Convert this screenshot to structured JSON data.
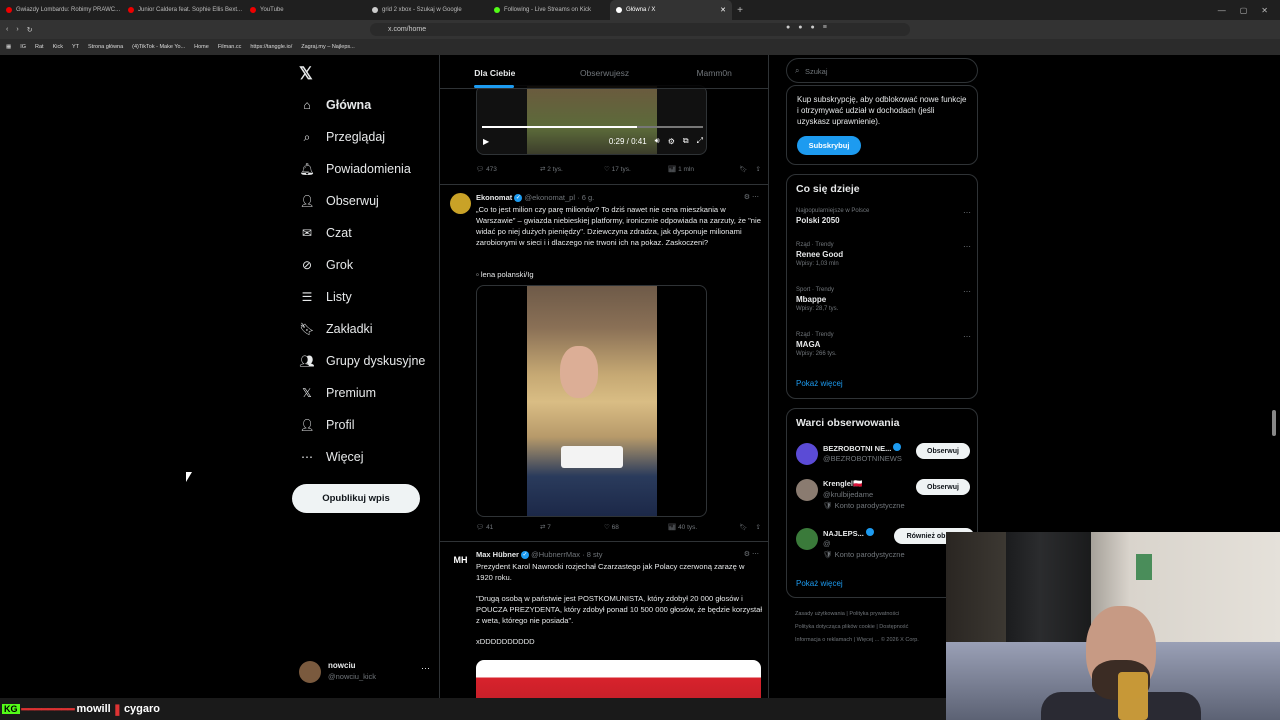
{
  "browser": {
    "tabs": [
      {
        "title": "Gwiazdy Lombardu: Robimy PRAWC..."
      },
      {
        "title": "Junior Caldera feat. Sophie Ellis Bext..."
      },
      {
        "title": "YouTube"
      },
      {
        "title": "grid 2 xbox - Szukaj w Google"
      },
      {
        "title": "Following - Live Streams on Kick"
      },
      {
        "title": "Główna / X"
      }
    ],
    "url": "x.com/home",
    "bookmarks": [
      "IG",
      "Rat",
      "Kick",
      "YT",
      "Strona główna",
      "(4)TikTok - Make Yo...",
      "Home",
      "Filman.cc",
      "https://tanggle.io/",
      "Zagraj.my – Najleps..."
    ]
  },
  "nav": {
    "items": [
      {
        "label": "Główna",
        "icon": "home-icon"
      },
      {
        "label": "Przeglądaj",
        "icon": "search-icon"
      },
      {
        "label": "Powiadomienia",
        "icon": "bell-icon"
      },
      {
        "label": "Obserwuj",
        "icon": "follow-icon"
      },
      {
        "label": "Czat",
        "icon": "mail-icon"
      },
      {
        "label": "Grok",
        "icon": "grok-icon"
      },
      {
        "label": "Listy",
        "icon": "list-icon"
      },
      {
        "label": "Zakładki",
        "icon": "bookmark-icon"
      },
      {
        "label": "Grupy dyskusyjne",
        "icon": "community-icon"
      },
      {
        "label": "Premium",
        "icon": "x-icon"
      },
      {
        "label": "Profil",
        "icon": "profile-icon"
      },
      {
        "label": "Więcej",
        "icon": "more-icon"
      }
    ],
    "post_button": "Opublikuj wpis",
    "profile": {
      "name": "nowciu",
      "handle": "@nowciu_kick"
    }
  },
  "feed": {
    "tabs": [
      "Dla Ciebie",
      "Obserwujesz",
      "Mamm0n"
    ],
    "video1": {
      "time": "0:29 / 0:41",
      "progress": 0.7
    },
    "post0_actions": {
      "replies": "473",
      "reposts": "2 tys.",
      "likes": "17 tys.",
      "views": "1 mln"
    },
    "post1": {
      "name": "Ekonomat",
      "handle": "@ekonomat_pl",
      "age": "6 g.",
      "text": "„Co to jest milion czy parę milionów? To dziś nawet nie cena mieszkania w Warszawie” – gwiazda niebieskiej platformy, ironicznie odpowiada na zarzuty, że \"nie widać po niej dużych pieniędzy\". Dziewczyna zdradza, jak dysponuje milionami zarobionymi w sieci i i dlaczego nie trwoni ich na pokaz. Zaskoczeni?",
      "credit": "lena polanski/Ig",
      "actions": {
        "replies": "41",
        "reposts": "7",
        "likes": "68",
        "views": "40 tys."
      }
    },
    "post2": {
      "name": "Max Hübner",
      "handle": "@HubnerrMax",
      "age": "8 sty",
      "text1": "Prezydent Karol Nawrocki rozjechał Czarzastego jak Polacy czerwoną zarazę w 1920 roku.",
      "text2": "\"Drugą osobą w państwie jest POSTKOMUNISTA, który zdobył 20 000 głosów i POUCZA PREZYDENTA, który zdobył ponad 10 500 000 głosów, że będzie korzystał z weta, którego nie posiada\".",
      "text3": "xDDDDDDDDDD",
      "avatar_text": "MH"
    }
  },
  "sidebar": {
    "search_placeholder": "Szukaj",
    "subscribe": {
      "text": "Kup subskrypcję, aby odblokować nowe funkcje i otrzymywać udział w dochodach (jeśli uzyskasz uprawnienie).",
      "button": "Subskrybuj"
    },
    "trends_title": "Co się dzieje",
    "trends": [
      {
        "context": "Najpopularniejsze w Polsce",
        "name": "Polski 2050",
        "posts": ""
      },
      {
        "context": "Rząd · Trendy",
        "name": "Renee Good",
        "posts": "Wpisy: 1,03 mln"
      },
      {
        "context": "Sport · Trendy",
        "name": "Mbappe",
        "posts": "Wpisy: 28,7 tys."
      },
      {
        "context": "Rząd · Trendy",
        "name": "MAGA",
        "posts": "Wpisy: 266 tys."
      }
    ],
    "show_more": "Pokaż więcej",
    "who_title": "Warci obserwowania",
    "who": [
      {
        "name": "BEZROBOTNI NE...",
        "handle": "@BEZROBOTNINEWS",
        "note": "",
        "button": "Obserwuj"
      },
      {
        "name": "Krenglel🇵🇱",
        "handle": "@krulbijedame",
        "note": "Konto parodystyczne",
        "button": "Obserwuj"
      },
      {
        "name": "NAJLEPS...",
        "handle": "@",
        "note": "Konto parodystyczne",
        "button": "Również obser..."
      }
    ],
    "footer": [
      "Zasady użytkowania",
      "Polityka prywatności",
      "Polityka dotycząca plików cookie",
      "Dostępność",
      "Informacja o reklamach",
      "Więcej ...",
      "© 2026 X Corp."
    ]
  },
  "overlay": {
    "chat_tag": "KG",
    "chat_text1": "mowill",
    "chat_text2": "cygaro"
  },
  "colors": {
    "accent": "#1d9bf0",
    "bg": "#000000",
    "border": "#2f3336",
    "muted": "#71767b"
  }
}
